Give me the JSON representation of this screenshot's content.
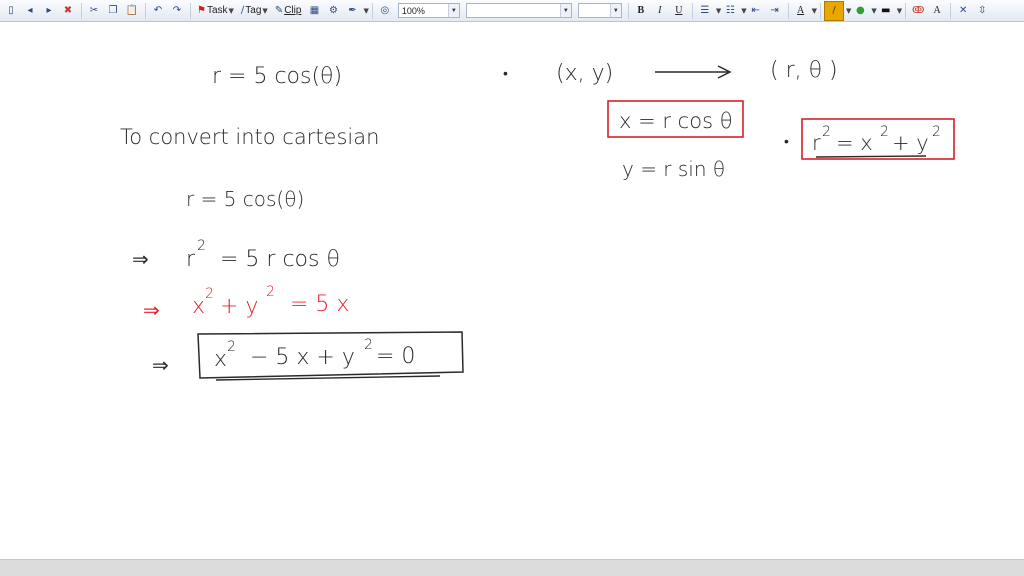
{
  "toolbar": {
    "task_label": "Task",
    "tag_label": "Tag",
    "clip_label": "Clip",
    "zoom_value": "100%",
    "font_value": "",
    "size_value": "",
    "bold_label": "B",
    "italic_label": "I",
    "underline_label": "U",
    "text_color_label": "A",
    "font_size_label": "A",
    "pen_color": "#e8a800",
    "highlight_color": "#2f9f2f"
  },
  "note": {
    "line1": "r = 5 cos(θ)",
    "dot1": "•",
    "xy": "(x, y)",
    "rtheta": "( r, θ )",
    "convert_text": "To convert into cartesian",
    "box1": "x = r cos θ",
    "y_eq": "y = r sin θ",
    "box2_r": "r",
    "box2_rest": "= x",
    "box2_y": "+ y",
    "sq": "2",
    "step1": "r = 5 cos(θ)",
    "imp1": "⇒",
    "step2a": "r",
    "step2b": "= 5 r cos θ",
    "imp2": "⇒",
    "step3a": "x",
    "step3b": "+ y",
    "step3c": "= 5 x",
    "imp3": "⇒",
    "step4a": "x",
    "step4b": "− 5 x + y",
    "step4c": "= 0"
  },
  "colors": {
    "ink": "#2a2a2a",
    "red": "#e8202a",
    "box_red": "#d8202a"
  }
}
